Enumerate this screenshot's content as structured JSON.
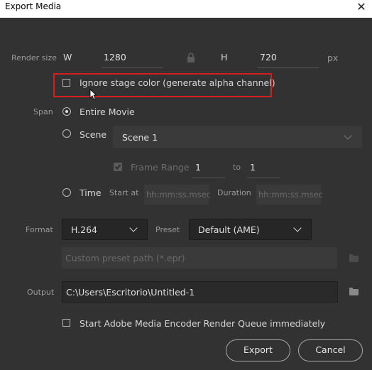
{
  "window": {
    "title": "Export Media",
    "close_glyph": "✕"
  },
  "render_size": {
    "label": "Render size",
    "w_label": "W",
    "width": "1280",
    "h_label": "H",
    "height": "720",
    "unit": "px",
    "lock_icon": "lock-icon"
  },
  "ignore_stage": {
    "label": "Ignore stage color (generate alpha channel)",
    "checked": false
  },
  "span": {
    "label": "Span",
    "entire_movie": "Entire Movie",
    "scene_label": "Scene",
    "scene_value": "Scene 1",
    "frame_range_label": "Frame Range",
    "frame_from": "1",
    "frame_to_label": "to",
    "frame_to": "1",
    "time_label": "Time",
    "start_at_label": "Start at",
    "start_placeholder": "hh:mm:ss.msec",
    "duration_label": "Duration",
    "duration_placeholder": "hh:mm:ss.msec",
    "selected": "Entire Movie"
  },
  "format": {
    "label": "Format",
    "value": "H.264",
    "preset_label": "Preset",
    "preset_value": "Default (AME)",
    "custom_preset_placeholder": "Custom preset path (*.epr)"
  },
  "output": {
    "label": "Output",
    "path": "C:\\Users\\Escritorio\\Untitled-1"
  },
  "queue": {
    "label": "Start Adobe Media Encoder Render Queue immediately",
    "checked": false
  },
  "buttons": {
    "export": "Export",
    "cancel": "Cancel"
  },
  "colors": {
    "background": "#323232",
    "highlight": "#d21f1f",
    "titlebar": "#ffffff"
  }
}
